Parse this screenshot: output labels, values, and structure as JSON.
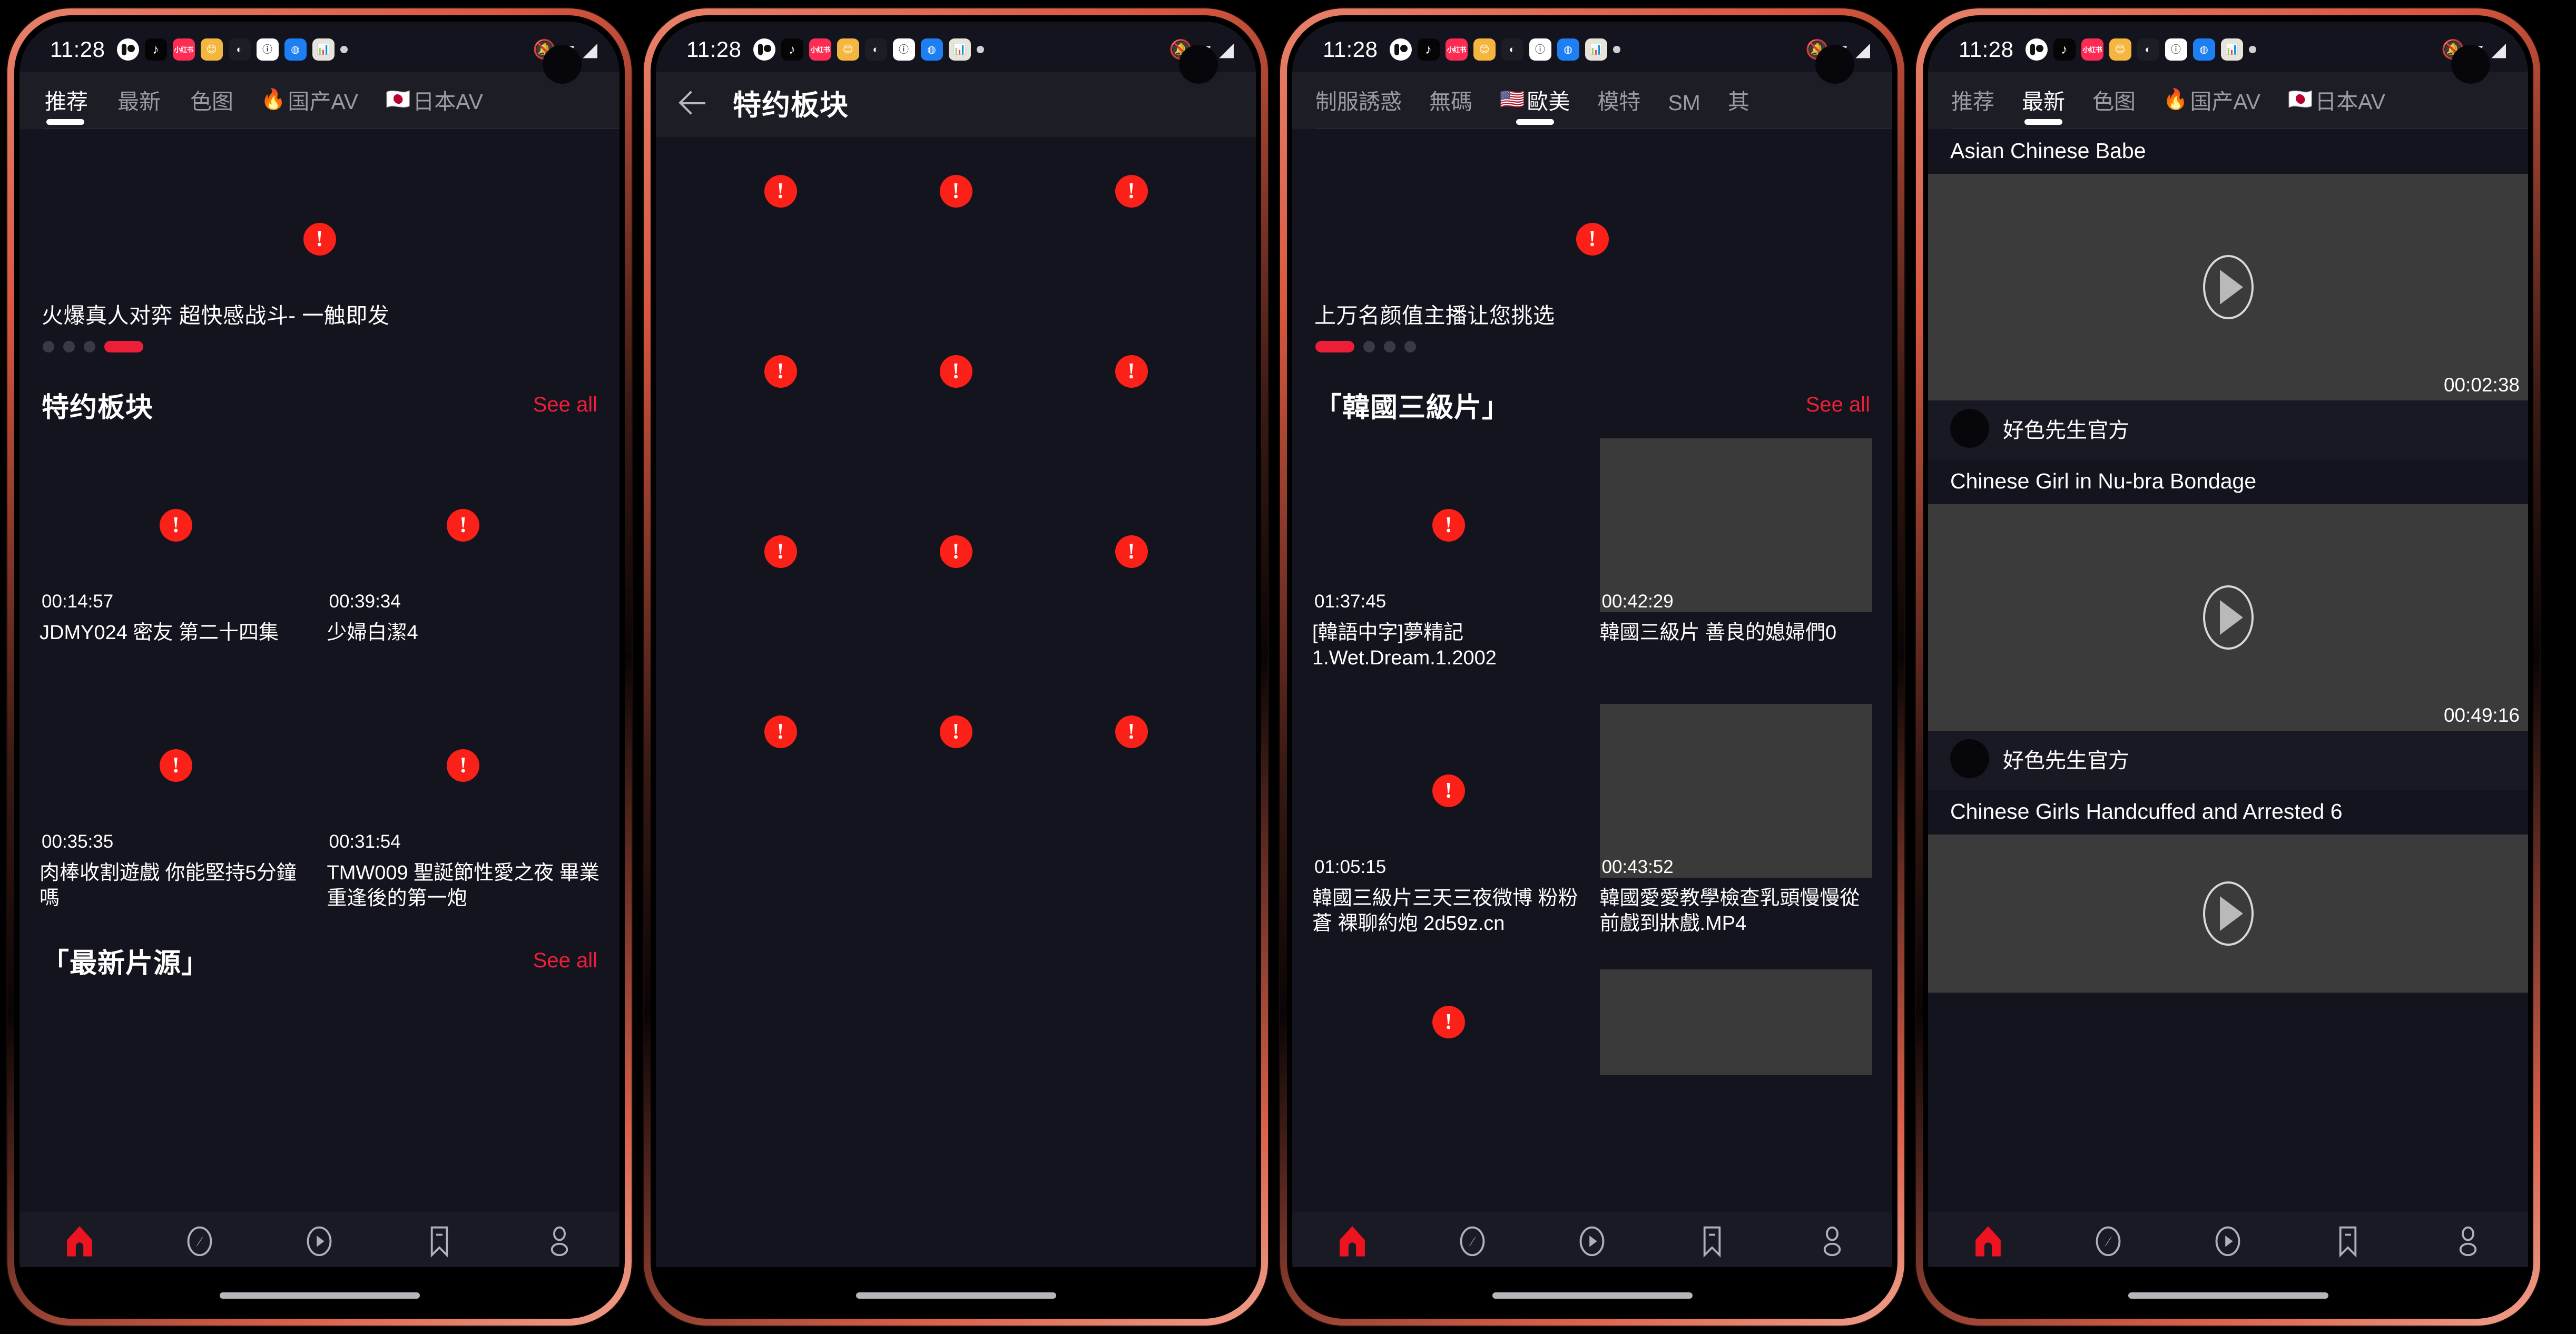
{
  "status_bar": {
    "time": "11:28",
    "left_icons": [
      "oval-face-icon",
      "tiktok-icon",
      "xiaohongshu-icon",
      "emoji-app-icon",
      "clock-app-icon",
      "info-app-icon",
      "globe-app-icon",
      "browser-app-icon",
      "chart-app-icon",
      "dot-icon"
    ],
    "right_icons": [
      "notifications-off-icon",
      "wifi-icon",
      "signal-icon"
    ],
    "xhs_label": "小红书"
  },
  "phone1": {
    "tabs": [
      {
        "label": "推荐",
        "emoji": "",
        "active": true
      },
      {
        "label": "最新",
        "emoji": "",
        "active": false
      },
      {
        "label": "色图",
        "emoji": "",
        "active": false
      },
      {
        "label": "国产AV",
        "emoji": "🔥",
        "active": false
      },
      {
        "label": "日本AV",
        "emoji": "🇯🇵",
        "active": false
      }
    ],
    "banner": {
      "caption": "火爆真人对弈 超快感战斗- 一触即发",
      "dots": 4,
      "active_dot": 3
    },
    "section1": {
      "title": "特约板块",
      "see_all": "See all"
    },
    "section2": {
      "title": "「最新片源」",
      "see_all": "See all"
    },
    "videos": [
      {
        "duration": "00:14:57",
        "title": "JDMY024 密友 第二十四集"
      },
      {
        "duration": "00:39:34",
        "title": "少婦白潔4"
      },
      {
        "duration": "00:35:35",
        "title": "肉棒收割遊戲 你能堅持5分鐘嗎"
      },
      {
        "duration": "00:31:54",
        "title": "TMW009 聖誕節性愛之夜 畢業重逢後的第一炮"
      }
    ],
    "bottom_nav": [
      {
        "label": "Home",
        "icon": "home-icon",
        "active": true
      },
      {
        "label": "Explore",
        "icon": "compass-icon",
        "active": false
      },
      {
        "label": "Movies",
        "icon": "play-circle-icon",
        "active": false
      },
      {
        "label": "My List",
        "icon": "bookmark-icon",
        "active": false
      },
      {
        "label": "Profile",
        "icon": "person-icon",
        "active": false
      }
    ]
  },
  "phone2": {
    "back_icon": "back-arrow-icon",
    "title": "特约板块",
    "tiles": 12,
    "tile_icon": "broken-image-icon"
  },
  "phone3": {
    "tabs": [
      {
        "label": "制服誘惑",
        "emoji": "",
        "active": false
      },
      {
        "label": "無碼",
        "emoji": "",
        "active": false
      },
      {
        "label": "歐美",
        "emoji": "🇺🇸",
        "active": true
      },
      {
        "label": "模特",
        "emoji": "",
        "active": false
      },
      {
        "label": "SM",
        "emoji": "",
        "active": false
      },
      {
        "label": "其",
        "emoji": "",
        "active": false
      }
    ],
    "banner": {
      "caption": "上万名颜值主播让您挑选",
      "dots": 4,
      "active_dot": 0
    },
    "section": {
      "title": "「韓國三級片」",
      "see_all": "See all"
    },
    "videos": [
      {
        "duration": "01:37:45",
        "title": "[韓語中字]夢精記 1.Wet.Dream.1.2002",
        "shaded": false
      },
      {
        "duration": "00:42:29",
        "title": "韓國三級片 善良的媳婦們0",
        "shaded": true
      },
      {
        "duration": "01:05:15",
        "title": "韓國三級片三天三夜微博 粉粉蒼 裸聊約炮 2d59z.cn",
        "shaded": false
      },
      {
        "duration": "00:43:52",
        "title": "韓國愛愛教學檢查乳頭慢慢從前戲到牀戲.MP4",
        "shaded": true
      }
    ],
    "bottom_nav": [
      {
        "label": "Home",
        "icon": "home-icon",
        "active": true
      },
      {
        "label": "Explore",
        "icon": "compass-icon",
        "active": false
      },
      {
        "label": "Movies",
        "icon": "play-circle-icon",
        "active": false
      },
      {
        "label": "My List",
        "icon": "bookmark-icon",
        "active": false
      },
      {
        "label": "Profile",
        "icon": "person-icon",
        "active": false
      }
    ]
  },
  "phone4": {
    "tabs": [
      {
        "label": "推荐",
        "emoji": "",
        "active": false
      },
      {
        "label": "最新",
        "emoji": "",
        "active": true
      },
      {
        "label": "色图",
        "emoji": "",
        "active": false
      },
      {
        "label": "国产AV",
        "emoji": "🔥",
        "active": false
      },
      {
        "label": "日本AV",
        "emoji": "🇯🇵",
        "active": false
      }
    ],
    "feed": [
      {
        "title": "Asian Chinese Babe",
        "duration": "00:02:38",
        "author": "好色先生官方",
        "play_icon": "play-icon"
      },
      {
        "title": "Chinese Girl in Nu-bra Bondage",
        "duration": "00:49:16",
        "author": "好色先生官方",
        "play_icon": "play-icon"
      },
      {
        "title": "Chinese Girls Handcuffed and Arrested 6",
        "duration": "",
        "author": "",
        "play_icon": "play-icon"
      }
    ],
    "bottom_nav": [
      {
        "label": "主页",
        "icon": "home-icon",
        "active": true
      },
      {
        "label": "探索",
        "icon": "compass-icon",
        "active": false
      },
      {
        "label": "电影",
        "icon": "play-circle-icon",
        "active": false
      },
      {
        "label": "关注列表",
        "icon": "bookmark-icon",
        "active": false
      },
      {
        "label": "个人资料",
        "icon": "person-icon",
        "active": false
      }
    ]
  },
  "colors": {
    "accent_red": "#ee1f38",
    "bg_dark": "#14141e",
    "bar_dark": "#1d1d26",
    "frame": "#d9573f"
  }
}
